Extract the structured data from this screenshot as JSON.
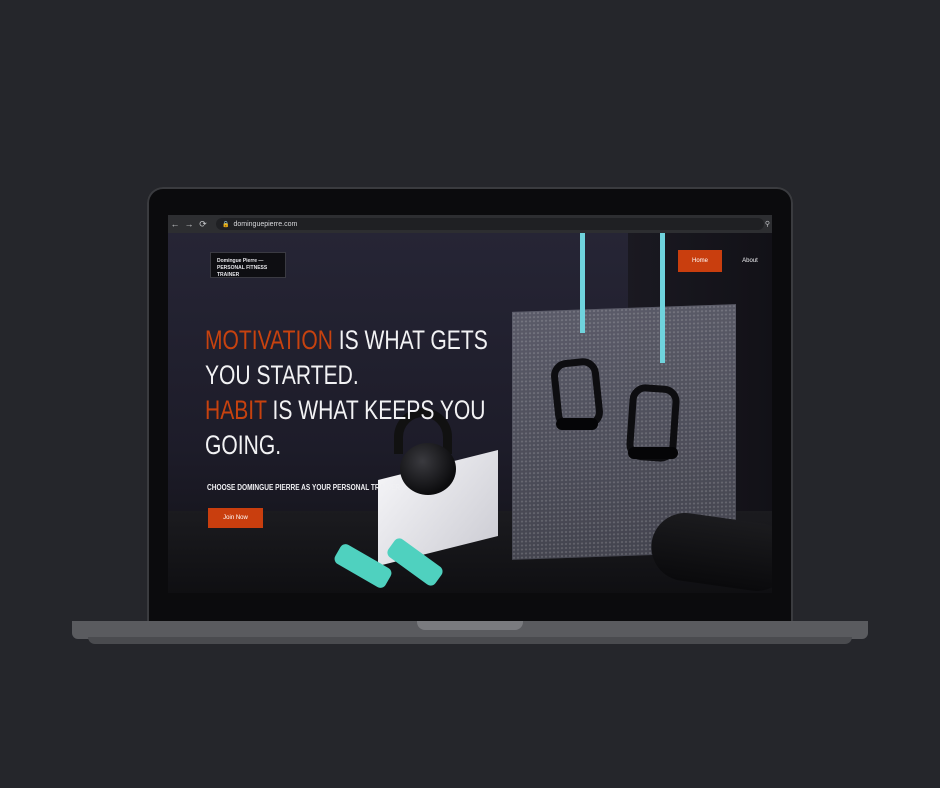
{
  "browser": {
    "url": "dominguepierre.com",
    "back_icon": "←",
    "forward_icon": "→",
    "reload_icon": "⟳"
  },
  "site": {
    "logo_line1": "Domingue Pierre —",
    "logo_line2": "PERSONAL FITNESS TRAINER",
    "nav": {
      "home": "Home",
      "about": "About"
    },
    "headline": {
      "line1_accent": "MOTIVATION",
      "line1_rest": " IS WHAT GETS",
      "line2": "YOU STARTED.",
      "line3_accent": "HABIT",
      "line3_rest": " IS WHAT KEEPS YOU",
      "line4": "GOING."
    },
    "subheadline": "CHOOSE DOMINGUE PIERRE AS YOUR PERSONAL TRAINER",
    "cta_label": "Join Now"
  },
  "colors": {
    "accent": "#c93e0e",
    "background": "#25262b",
    "rope": "#6fd3dd",
    "dumbbell": "#4fd1bf"
  }
}
